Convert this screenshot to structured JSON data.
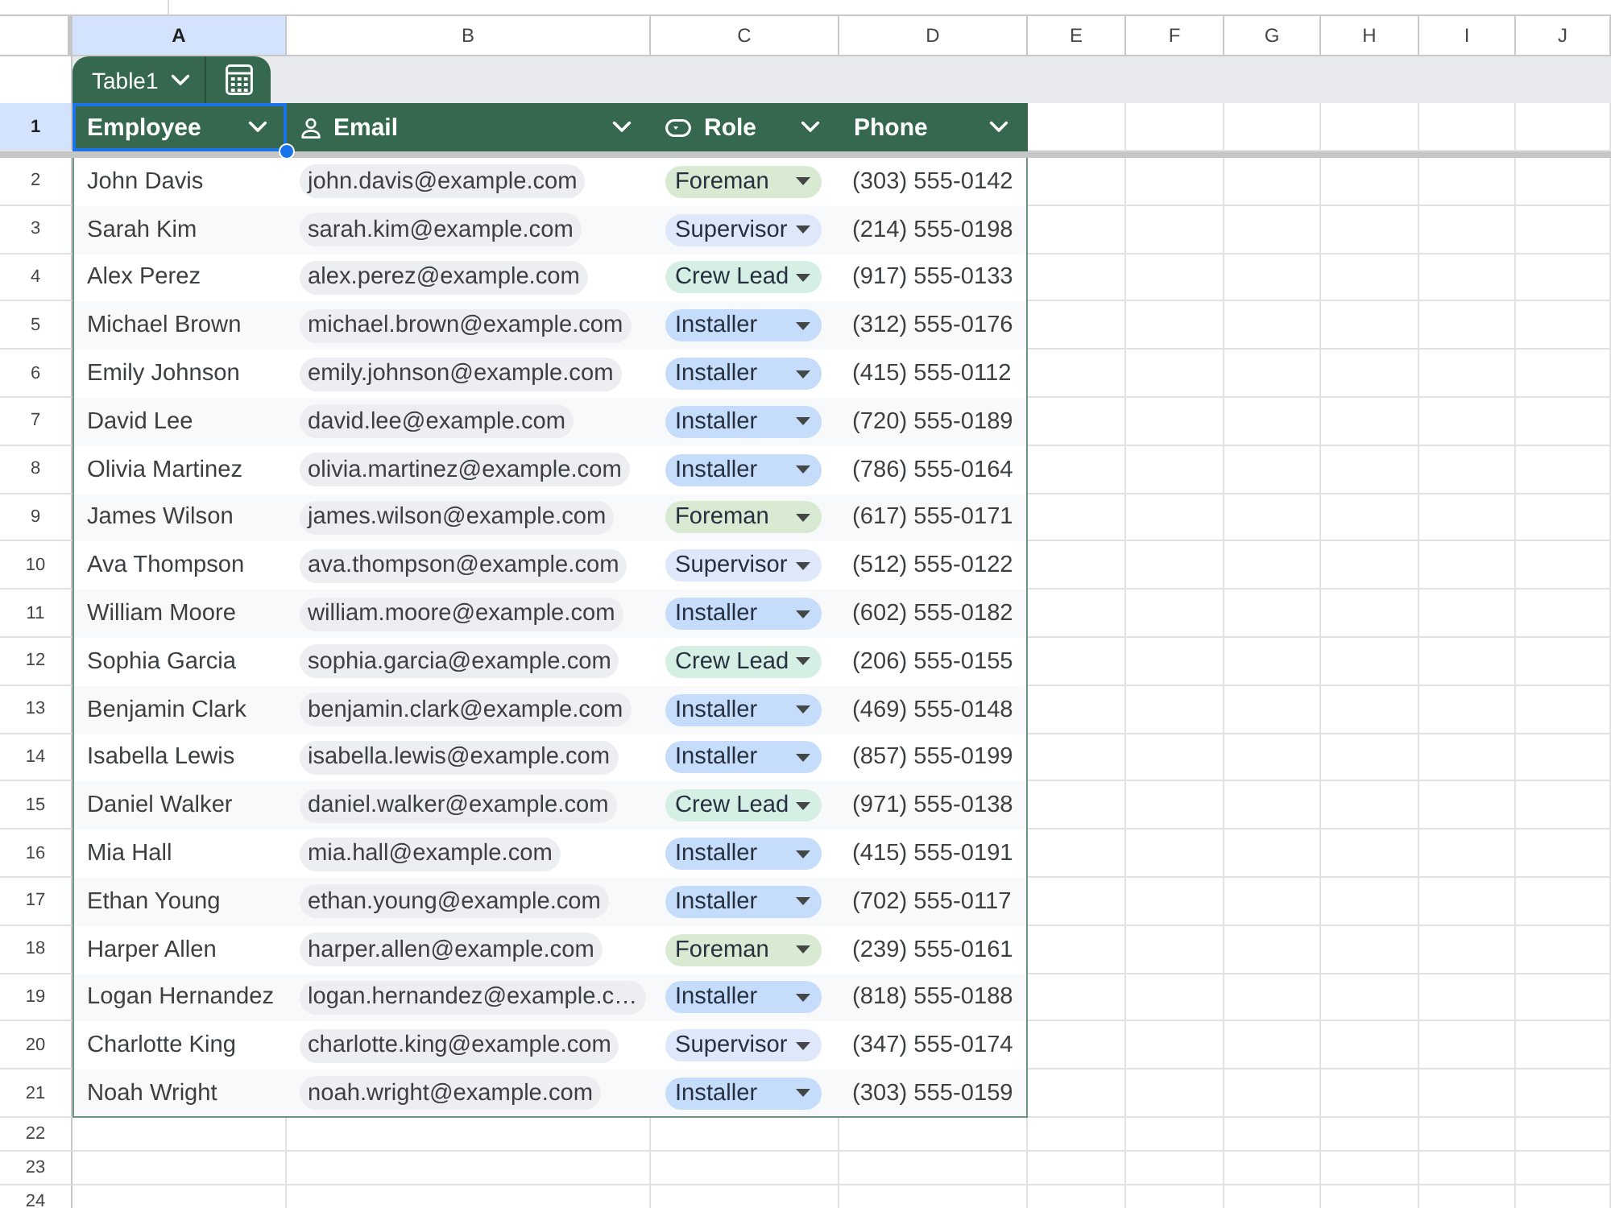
{
  "column_letters": [
    {
      "label": "A",
      "selected": true
    },
    {
      "label": "B",
      "selected": false
    },
    {
      "label": "C",
      "selected": false
    },
    {
      "label": "D",
      "selected": false
    },
    {
      "label": "E",
      "selected": false
    },
    {
      "label": "F",
      "selected": false
    },
    {
      "label": "G",
      "selected": false
    },
    {
      "label": "H",
      "selected": false
    },
    {
      "label": "I",
      "selected": false
    },
    {
      "label": "J",
      "selected": false
    }
  ],
  "table": {
    "name": "Table1",
    "header_row": {
      "number": "1",
      "selected": true
    },
    "columns": [
      {
        "label": "Employee",
        "kind": "text",
        "selected": true
      },
      {
        "label": "Email",
        "kind": "person",
        "selected": false
      },
      {
        "label": "Role",
        "kind": "dropdown",
        "selected": false
      },
      {
        "label": "Phone",
        "kind": "text",
        "selected": false
      }
    ],
    "rows": [
      {
        "number": "2",
        "selected": false,
        "cells": [
          {
            "text": "John Davis"
          },
          {
            "text": "john.davis@example.com"
          },
          {
            "text": "Foreman",
            "color": "#d9ead3"
          },
          {
            "text": "(303) 555-0142"
          }
        ]
      },
      {
        "number": "3",
        "selected": false,
        "cells": [
          {
            "text": "Sarah Kim"
          },
          {
            "text": "sarah.kim@example.com"
          },
          {
            "text": "Supervisor",
            "color": "#dfe7fb"
          },
          {
            "text": "(214) 555-0198"
          }
        ]
      },
      {
        "number": "4",
        "selected": false,
        "cells": [
          {
            "text": "Alex Perez"
          },
          {
            "text": "alex.perez@example.com"
          },
          {
            "text": "Crew Lead",
            "color": "#d6efe4"
          },
          {
            "text": "(917) 555-0133"
          }
        ]
      },
      {
        "number": "5",
        "selected": false,
        "cells": [
          {
            "text": "Michael Brown"
          },
          {
            "text": "michael.brown@example.com"
          },
          {
            "text": "Installer",
            "color": "#c6dcfb"
          },
          {
            "text": "(312) 555-0176"
          }
        ]
      },
      {
        "number": "6",
        "selected": false,
        "cells": [
          {
            "text": "Emily Johnson"
          },
          {
            "text": "emily.johnson@example.com"
          },
          {
            "text": "Installer",
            "color": "#c6dcfb"
          },
          {
            "text": "(415) 555-0112"
          }
        ]
      },
      {
        "number": "7",
        "selected": false,
        "cells": [
          {
            "text": "David Lee"
          },
          {
            "text": "david.lee@example.com"
          },
          {
            "text": "Installer",
            "color": "#c6dcfb"
          },
          {
            "text": "(720) 555-0189"
          }
        ]
      },
      {
        "number": "8",
        "selected": false,
        "cells": [
          {
            "text": "Olivia Martinez"
          },
          {
            "text": "olivia.martinez@example.com"
          },
          {
            "text": "Installer",
            "color": "#c6dcfb"
          },
          {
            "text": "(786) 555-0164"
          }
        ]
      },
      {
        "number": "9",
        "selected": false,
        "cells": [
          {
            "text": "James Wilson"
          },
          {
            "text": "james.wilson@example.com"
          },
          {
            "text": "Foreman",
            "color": "#d9ead3"
          },
          {
            "text": "(617) 555-0171"
          }
        ]
      },
      {
        "number": "10",
        "selected": false,
        "cells": [
          {
            "text": "Ava Thompson"
          },
          {
            "text": "ava.thompson@example.com"
          },
          {
            "text": "Supervisor",
            "color": "#dfe7fb"
          },
          {
            "text": "(512) 555-0122"
          }
        ]
      },
      {
        "number": "11",
        "selected": false,
        "cells": [
          {
            "text": "William Moore"
          },
          {
            "text": "william.moore@example.com"
          },
          {
            "text": "Installer",
            "color": "#c6dcfb"
          },
          {
            "text": "(602) 555-0182"
          }
        ]
      },
      {
        "number": "12",
        "selected": false,
        "cells": [
          {
            "text": "Sophia Garcia"
          },
          {
            "text": "sophia.garcia@example.com"
          },
          {
            "text": "Crew Lead",
            "color": "#d6efe4"
          },
          {
            "text": "(206) 555-0155"
          }
        ]
      },
      {
        "number": "13",
        "selected": false,
        "cells": [
          {
            "text": "Benjamin Clark"
          },
          {
            "text": "benjamin.clark@example.com"
          },
          {
            "text": "Installer",
            "color": "#c6dcfb"
          },
          {
            "text": "(469) 555-0148"
          }
        ]
      },
      {
        "number": "14",
        "selected": false,
        "cells": [
          {
            "text": "Isabella Lewis"
          },
          {
            "text": "isabella.lewis@example.com"
          },
          {
            "text": "Installer",
            "color": "#c6dcfb"
          },
          {
            "text": "(857) 555-0199"
          }
        ]
      },
      {
        "number": "15",
        "selected": false,
        "cells": [
          {
            "text": "Daniel Walker"
          },
          {
            "text": "daniel.walker@example.com"
          },
          {
            "text": "Crew Lead",
            "color": "#d6efe4"
          },
          {
            "text": "(971) 555-0138"
          }
        ]
      },
      {
        "number": "16",
        "selected": false,
        "cells": [
          {
            "text": "Mia Hall"
          },
          {
            "text": "mia.hall@example.com"
          },
          {
            "text": "Installer",
            "color": "#c6dcfb"
          },
          {
            "text": "(415) 555-0191"
          }
        ]
      },
      {
        "number": "17",
        "selected": false,
        "cells": [
          {
            "text": "Ethan Young"
          },
          {
            "text": "ethan.young@example.com"
          },
          {
            "text": "Installer",
            "color": "#c6dcfb"
          },
          {
            "text": "(702) 555-0117"
          }
        ]
      },
      {
        "number": "18",
        "selected": false,
        "cells": [
          {
            "text": "Harper Allen"
          },
          {
            "text": "harper.allen@example.com"
          },
          {
            "text": "Foreman",
            "color": "#d9ead3"
          },
          {
            "text": "(239) 555-0161"
          }
        ]
      },
      {
        "number": "19",
        "selected": false,
        "cells": [
          {
            "text": "Logan Hernandez"
          },
          {
            "text": "logan.hernandez@example.c…"
          },
          {
            "text": "Installer",
            "color": "#c6dcfb"
          },
          {
            "text": "(818) 555-0188"
          }
        ]
      },
      {
        "number": "20",
        "selected": false,
        "cells": [
          {
            "text": "Charlotte King"
          },
          {
            "text": "charlotte.king@example.com"
          },
          {
            "text": "Supervisor",
            "color": "#dfe7fb"
          },
          {
            "text": "(347) 555-0174"
          }
        ]
      },
      {
        "number": "21",
        "selected": false,
        "cells": [
          {
            "text": "Noah Wright"
          },
          {
            "text": "noah.wright@example.com"
          },
          {
            "text": "Installer",
            "color": "#c6dcfb"
          },
          {
            "text": "(303) 555-0159"
          }
        ]
      }
    ]
  },
  "empty_rows": [
    {
      "number": "22",
      "selected": false
    },
    {
      "number": "23",
      "selected": false
    },
    {
      "number": "24",
      "selected": false
    }
  ]
}
